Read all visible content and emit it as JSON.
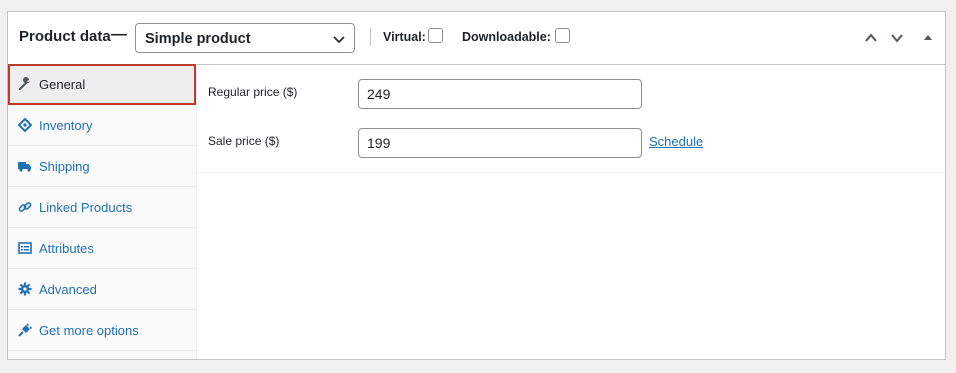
{
  "header": {
    "title": "Product data",
    "dash": "—",
    "product_type": "Simple product",
    "virtual_label": "Virtual:",
    "downloadable_label": "Downloadable:"
  },
  "sidebar": {
    "items": [
      {
        "label": "General",
        "icon": "wrench-icon"
      },
      {
        "label": "Inventory",
        "icon": "tag-icon"
      },
      {
        "label": "Shipping",
        "icon": "truck-icon"
      },
      {
        "label": "Linked Products",
        "icon": "link-icon"
      },
      {
        "label": "Attributes",
        "icon": "list-icon"
      },
      {
        "label": "Advanced",
        "icon": "gear-icon"
      },
      {
        "label": "Get more options",
        "icon": "plugin-icon"
      }
    ]
  },
  "general": {
    "regular_price_label": "Regular price ($)",
    "regular_price_value": "249",
    "sale_price_label": "Sale price ($)",
    "sale_price_value": "199",
    "schedule_link": "Schedule"
  },
  "colors": {
    "accent": "#2271b1",
    "highlight": "#c0392b"
  }
}
